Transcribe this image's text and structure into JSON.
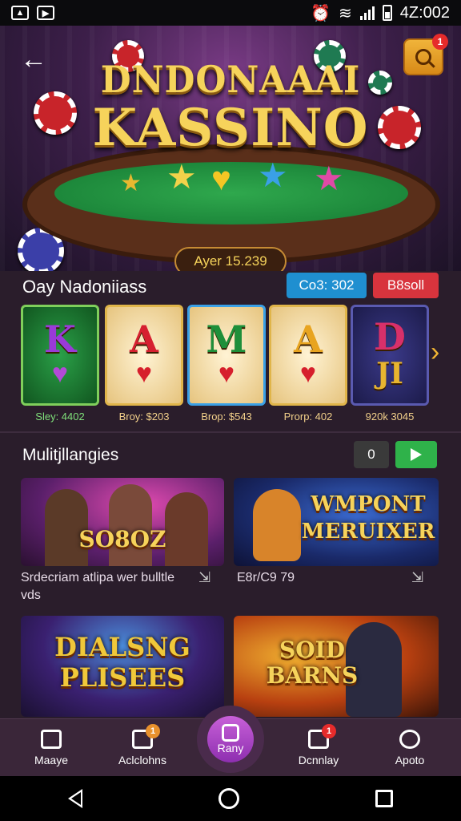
{
  "status_bar": {
    "time": "4Z:002",
    "left_icons": [
      "photo-icon",
      "video-icon"
    ],
    "right_icons": [
      "alarm-icon",
      "wifi-icon",
      "signal-icon",
      "battery-icon"
    ]
  },
  "header": {
    "title_line1": "DNDONAAAI",
    "title_line2": "KASSINO",
    "search_badge": "1",
    "jackpot": "Ayer 15.239"
  },
  "slots_section": {
    "title": "Oay Nadoniiass",
    "pill_blue": "Co3: 302",
    "pill_red": "B8soll",
    "cards": [
      {
        "symbol": "K",
        "caption": "Sley: 4402",
        "symbol_color": "#8a35c8",
        "bg": "#1b7a2e"
      },
      {
        "symbol": "A",
        "caption": "Broy: $203",
        "symbol_color": "#d62030",
        "bg": "#f2d9a8"
      },
      {
        "symbol": "M",
        "caption": "Brop: $543",
        "symbol_color": "#1e8f3a",
        "bg": "#f2d9a8"
      },
      {
        "symbol": "A",
        "caption": "Prorp: 402",
        "symbol_color": "#f2b533",
        "bg": "#f2d9a8"
      },
      {
        "symbol": "D",
        "caption": "920k 3045",
        "symbol_color": "#c52a6a",
        "bg": "#2b2a6b",
        "extra": "JI"
      }
    ]
  },
  "multi_section": {
    "title": "Mulitjllangies",
    "count_value": "0",
    "cards": [
      {
        "title": "SO8OZ",
        "caption": "Srdecriam atlipa wer bulltle vds"
      },
      {
        "title_line1": "WMPONT",
        "title_line2": "MERUIXER",
        "caption": "E8r/C9 79"
      },
      {
        "title_line1": "DIALSNG",
        "title_line2": "PLISEES",
        "caption": ""
      },
      {
        "title_line1": "SOID",
        "title_line2": "BARNS",
        "caption": ""
      }
    ]
  },
  "bottom_nav": {
    "items": [
      {
        "label": "Maaye",
        "icon": "home-icon"
      },
      {
        "label": "Aclclohns",
        "icon": "action-icon",
        "badge": "1"
      },
      {
        "label": "Rany",
        "icon": "dice-icon"
      },
      {
        "label": "Dcnnlay",
        "icon": "mail-icon",
        "badge": "1"
      },
      {
        "label": "Apoto",
        "icon": "profile-icon"
      }
    ]
  },
  "colors": {
    "accent_gold": "#f6d35b",
    "play_green": "#2fb24a",
    "pill_blue": "#1f8fd0",
    "pill_red": "#d8343d",
    "nav_bg": "#3a2639"
  }
}
